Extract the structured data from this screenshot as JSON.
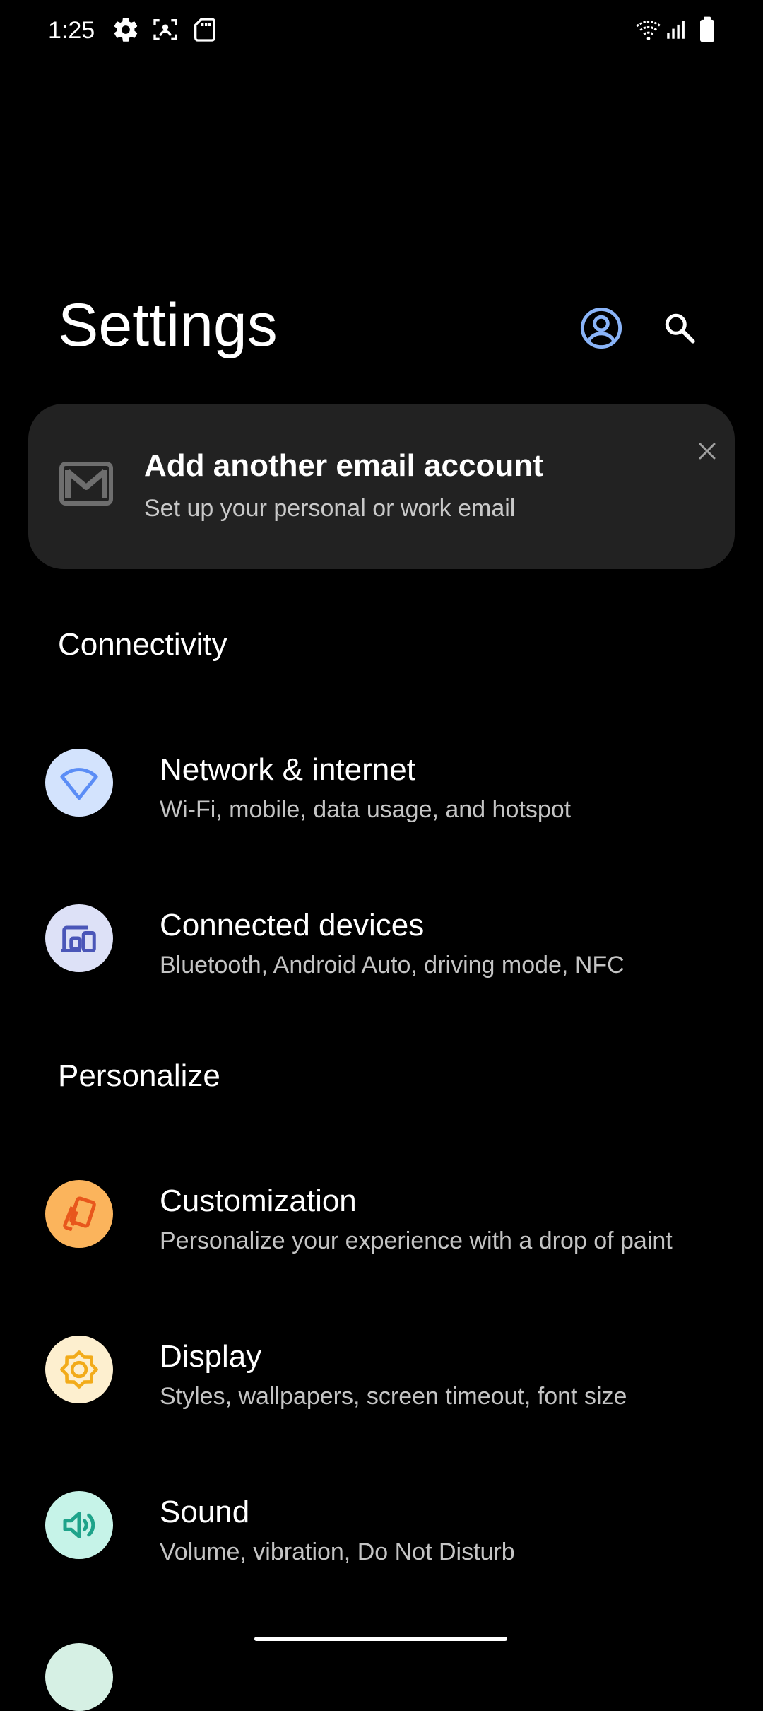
{
  "status_bar": {
    "time": "1:25",
    "icons_left": [
      "gear-icon",
      "screenshot-icon",
      "sd-card-icon"
    ],
    "icons_right": [
      "wifi-icon",
      "signal-icon",
      "battery-icon"
    ]
  },
  "header": {
    "title": "Settings",
    "account_icon": "account-circle-icon",
    "search_icon": "search-icon",
    "accent_color": "#8ab4f8"
  },
  "suggestion_card": {
    "title": "Add another email account",
    "subtitle": "Set up your personal or work email",
    "icon": "gmail-icon",
    "dismiss_icon": "close-icon"
  },
  "sections": [
    {
      "title": "Connectivity",
      "items": [
        {
          "title": "Network & internet",
          "subtitle": "Wi-Fi, mobile, data usage, and hotspot",
          "icon": "wifi-icon",
          "icon_bg": "#d3e3fd",
          "icon_color": "#5b8df6"
        },
        {
          "title": "Connected devices",
          "subtitle": "Bluetooth, Android Auto, driving mode, NFC",
          "icon": "devices-icon",
          "icon_bg": "#dde1f7",
          "icon_color": "#4a56b8"
        }
      ]
    },
    {
      "title": "Personalize",
      "items": [
        {
          "title": "Customization",
          "subtitle": "Personalize your experience with a drop of paint",
          "icon": "palette-icon",
          "icon_bg": "#fbb45c",
          "icon_color": "#e8571c"
        },
        {
          "title": "Display",
          "subtitle": "Styles, wallpapers, screen timeout, font size",
          "icon": "brightness-icon",
          "icon_bg": "#fdefcf",
          "icon_color": "#f2ab1a"
        },
        {
          "title": "Sound",
          "subtitle": "Volume, vibration, Do Not Disturb",
          "icon": "volume-icon",
          "icon_bg": "#c6f3e8",
          "icon_color": "#1ea38a"
        }
      ]
    }
  ]
}
